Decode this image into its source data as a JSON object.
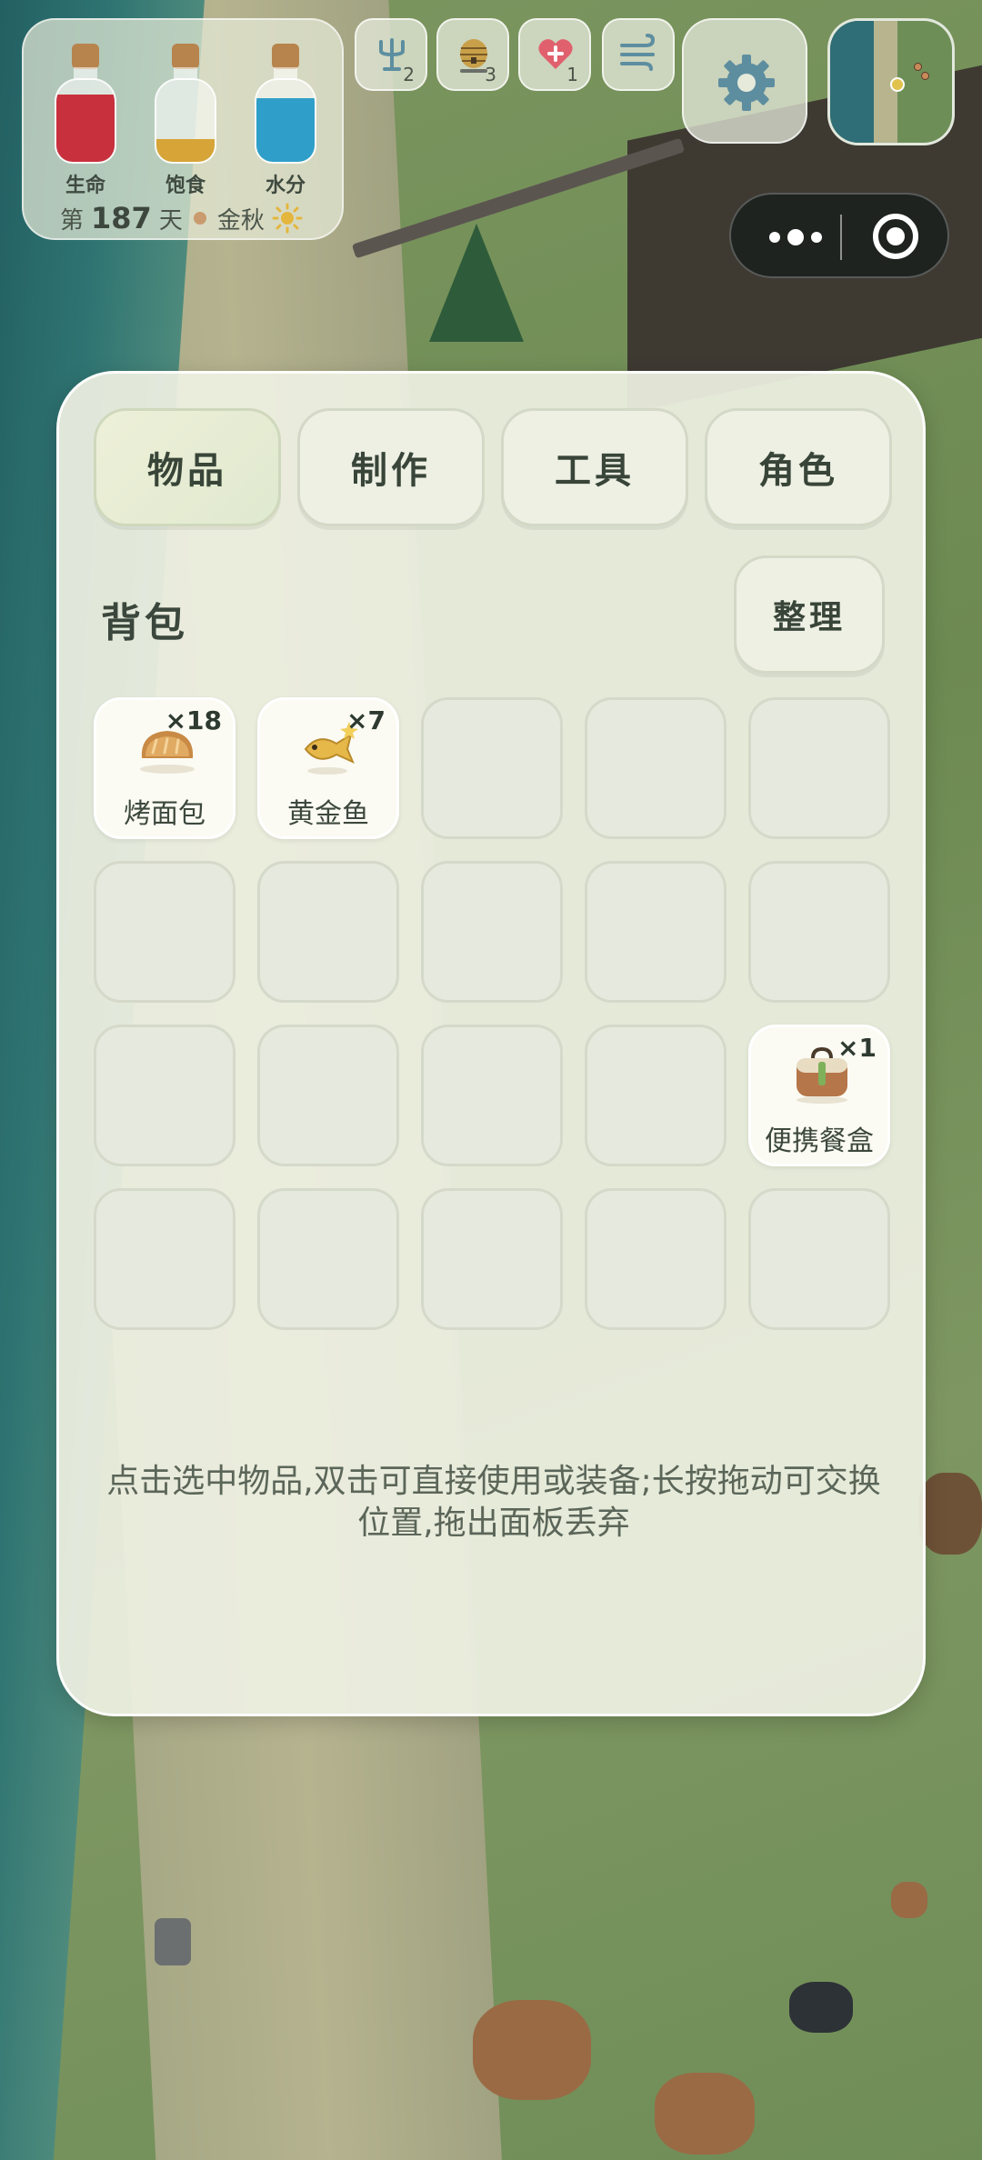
{
  "status": {
    "bottles": [
      {
        "label": "生命",
        "level": 0.82,
        "color": "#c9303d"
      },
      {
        "label": "饱食",
        "level": 0.28,
        "color": "#d6a437"
      },
      {
        "label": "水分",
        "level": 0.78,
        "color": "#2f9fc9"
      }
    ],
    "day_prefix": "第",
    "day_number": "187",
    "day_suffix": "天",
    "season": "金秋",
    "weather_icon": "sun-icon"
  },
  "buffs": [
    {
      "icon": "trident-icon",
      "count": "2"
    },
    {
      "icon": "beehive-icon",
      "count": "3"
    },
    {
      "icon": "heart-plus-icon",
      "count": "1"
    },
    {
      "icon": "wind-icon",
      "count": ""
    }
  ],
  "settings_icon": "gear-icon",
  "tabs": [
    {
      "label": "物品",
      "active": true
    },
    {
      "label": "制作",
      "active": false
    },
    {
      "label": "工具",
      "active": false
    },
    {
      "label": "角色",
      "active": false
    }
  ],
  "section_title": "背包",
  "sort_label": "整理",
  "slots": [
    {
      "name": "烤面包",
      "qty": "×18",
      "icon": "bread-icon"
    },
    {
      "name": "黄金鱼",
      "qty": "×7",
      "icon": "golden-fish-icon"
    },
    {},
    {},
    {},
    {},
    {},
    {},
    {},
    {},
    {},
    {},
    {},
    {},
    {
      "name": "便携餐盒",
      "qty": "×1",
      "icon": "lunchbox-icon"
    },
    {},
    {},
    {},
    {},
    {}
  ],
  "hint": "点击选中物品,双击可直接使用或装备;长按拖动可交换位置,拖出面板丢弃",
  "colors": {
    "accent_active_tab": "#dfe9cf",
    "text": "#384538"
  }
}
